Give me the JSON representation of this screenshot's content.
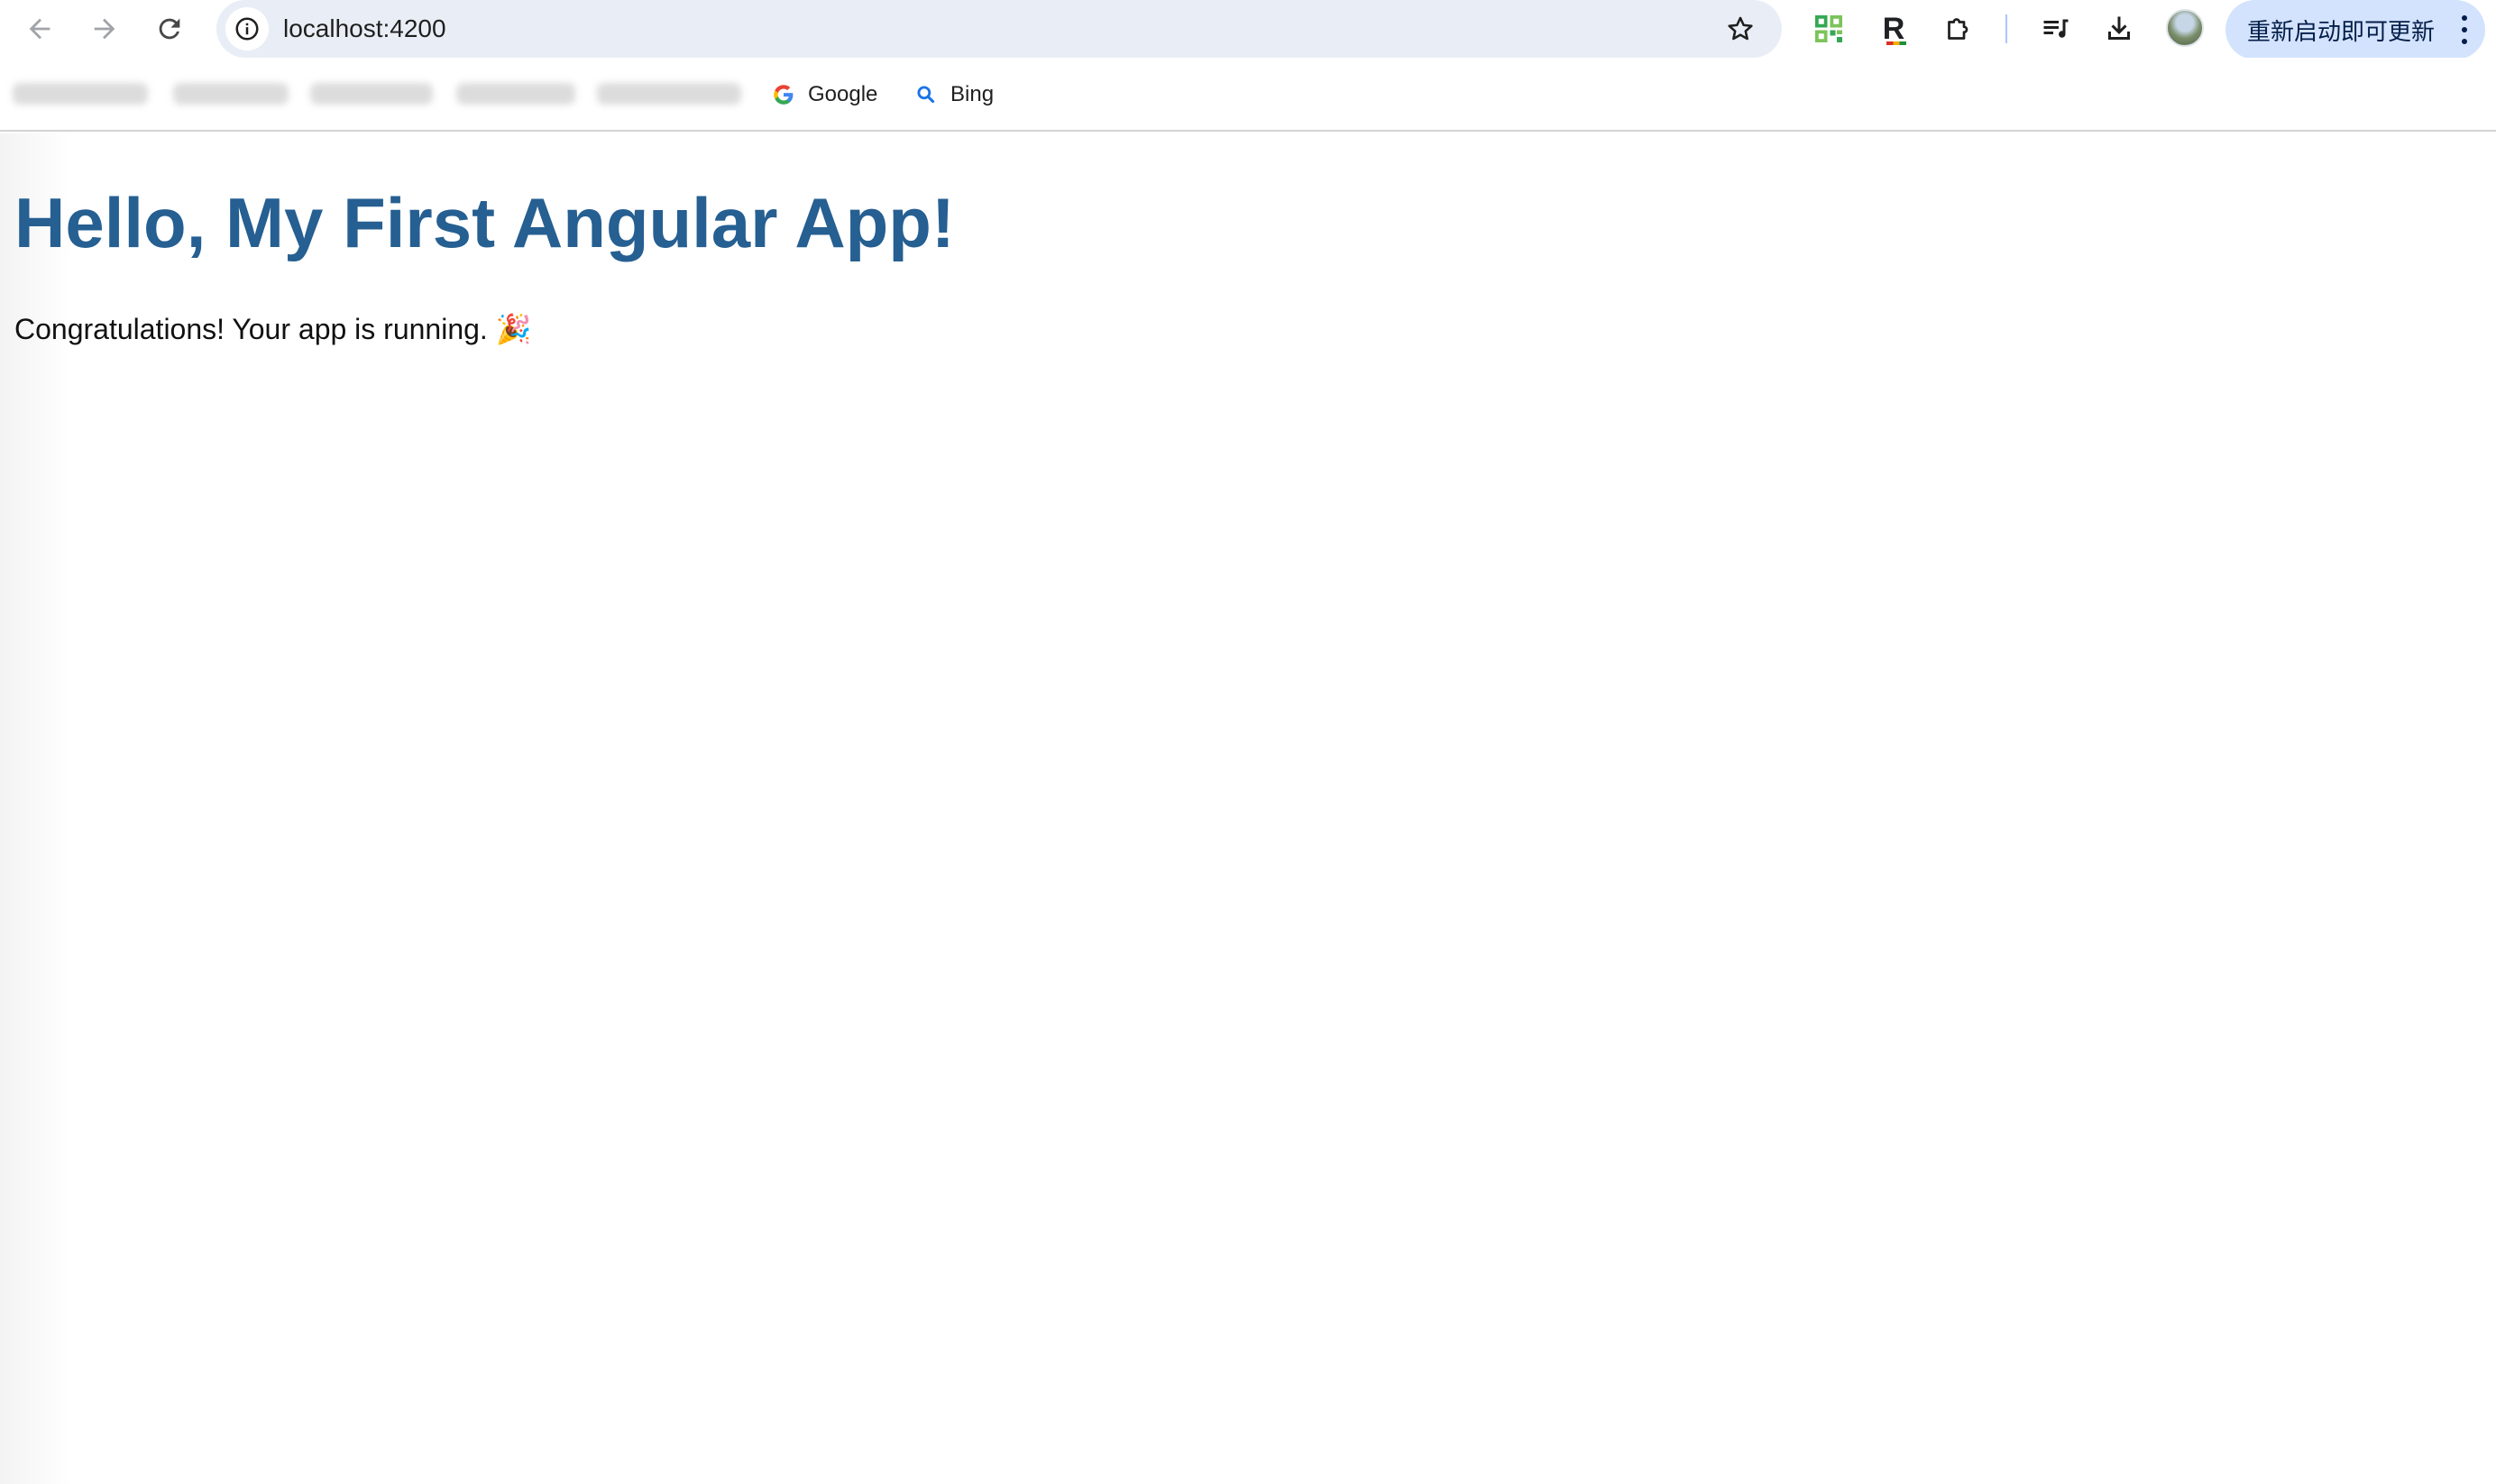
{
  "browser": {
    "url": "localhost:4200",
    "update_button_label": "重新启动即可更新",
    "icons": {
      "back": "back-arrow-icon",
      "forward": "forward-arrow-icon",
      "reload": "reload-icon",
      "site_info": "info-icon",
      "bookmark_star": "star-icon",
      "extensions": [
        "qr-code-extension-icon",
        "r-extension-icon",
        "puzzle-extensions-icon"
      ],
      "media": "media-controls-icon",
      "downloads": "download-icon",
      "menu": "kebab-menu-icon"
    },
    "extension_r_label": "R"
  },
  "bookmarks": {
    "items": [
      {
        "label": "Google",
        "icon": "google-icon"
      },
      {
        "label": "Bing",
        "icon": "bing-search-icon"
      }
    ]
  },
  "page": {
    "title": "Hello, My First Angular App!",
    "subtitle": "Congratulations! Your app is running. 🎉"
  },
  "colors": {
    "title": "#265f91",
    "omnibox_bg": "#e9eef6",
    "update_button_bg": "#d3e3fd"
  }
}
